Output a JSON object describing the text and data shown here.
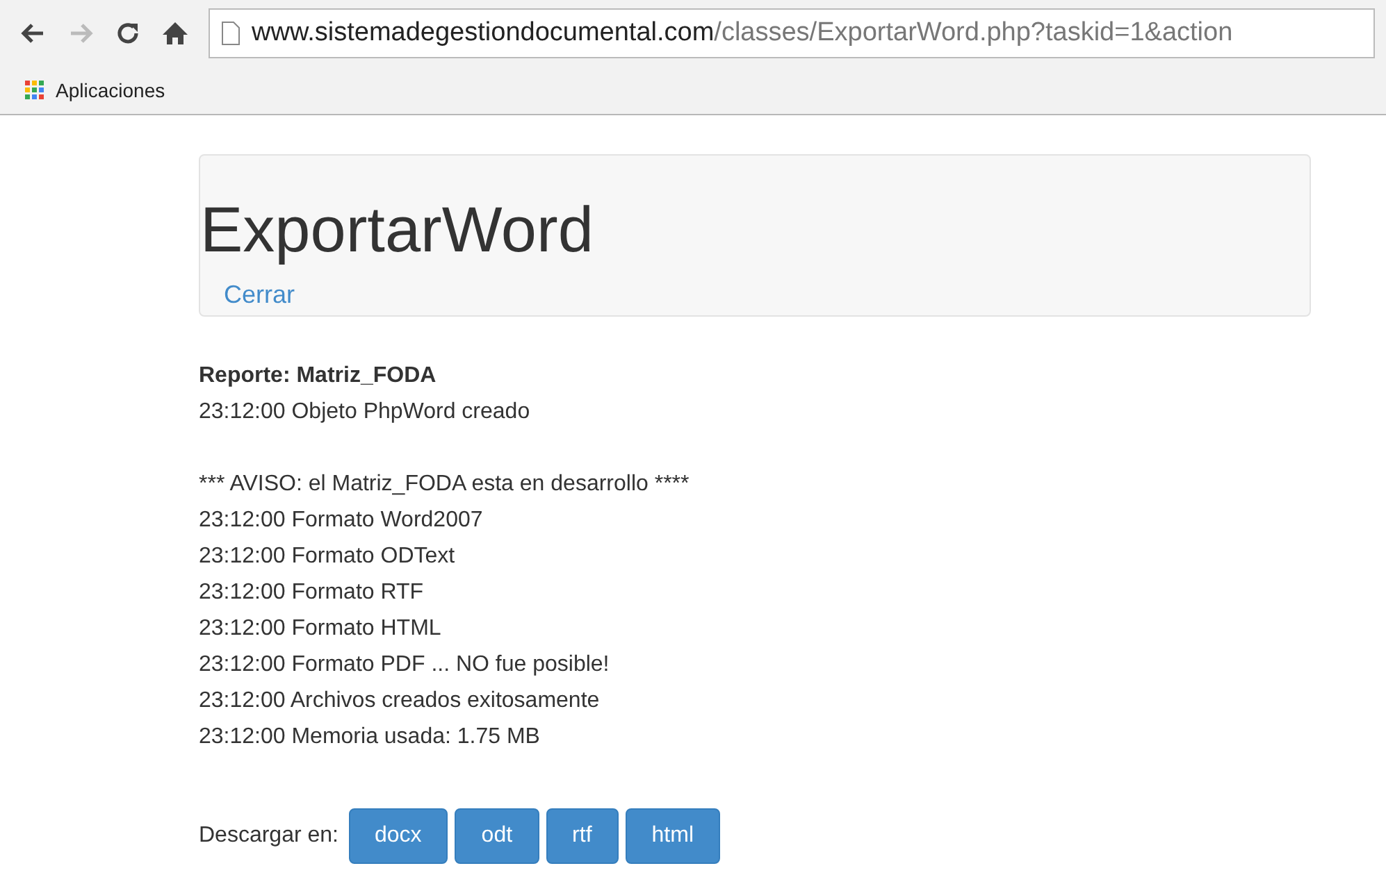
{
  "browser": {
    "url_host": "www.sistemadegestiondocumental.com",
    "url_path": "/classes/ExportarWord.php?taskid=1&action",
    "bookmarks": [
      {
        "label": "Aplicaciones"
      }
    ]
  },
  "header": {
    "title": "ExportarWord",
    "link": "Cerrar"
  },
  "report": {
    "title": "Reporte: Matriz_FODA",
    "intro_lines": [
      {
        "text": "23:12:00 Objeto PhpWord creado"
      }
    ],
    "lines": [
      {
        "text": "*** AVISO: el Matriz_FODA esta en desarrollo ****"
      },
      {
        "text": "23:12:00 Formato Word2007"
      },
      {
        "text": "23:12:00 Formato ODText"
      },
      {
        "text": "23:12:00 Formato RTF"
      },
      {
        "text": "23:12:00 Formato HTML"
      },
      {
        "text": "23:12:00 Formato PDF ... NO fue posible!"
      },
      {
        "text": "23:12:00 Archivos creados exitosamente"
      },
      {
        "text": "23:12:00 Memoria usada: 1.75 MB"
      }
    ]
  },
  "download": {
    "label": "Descargar en:",
    "buttons": [
      "docx",
      "odt",
      "rtf",
      "html"
    ]
  }
}
